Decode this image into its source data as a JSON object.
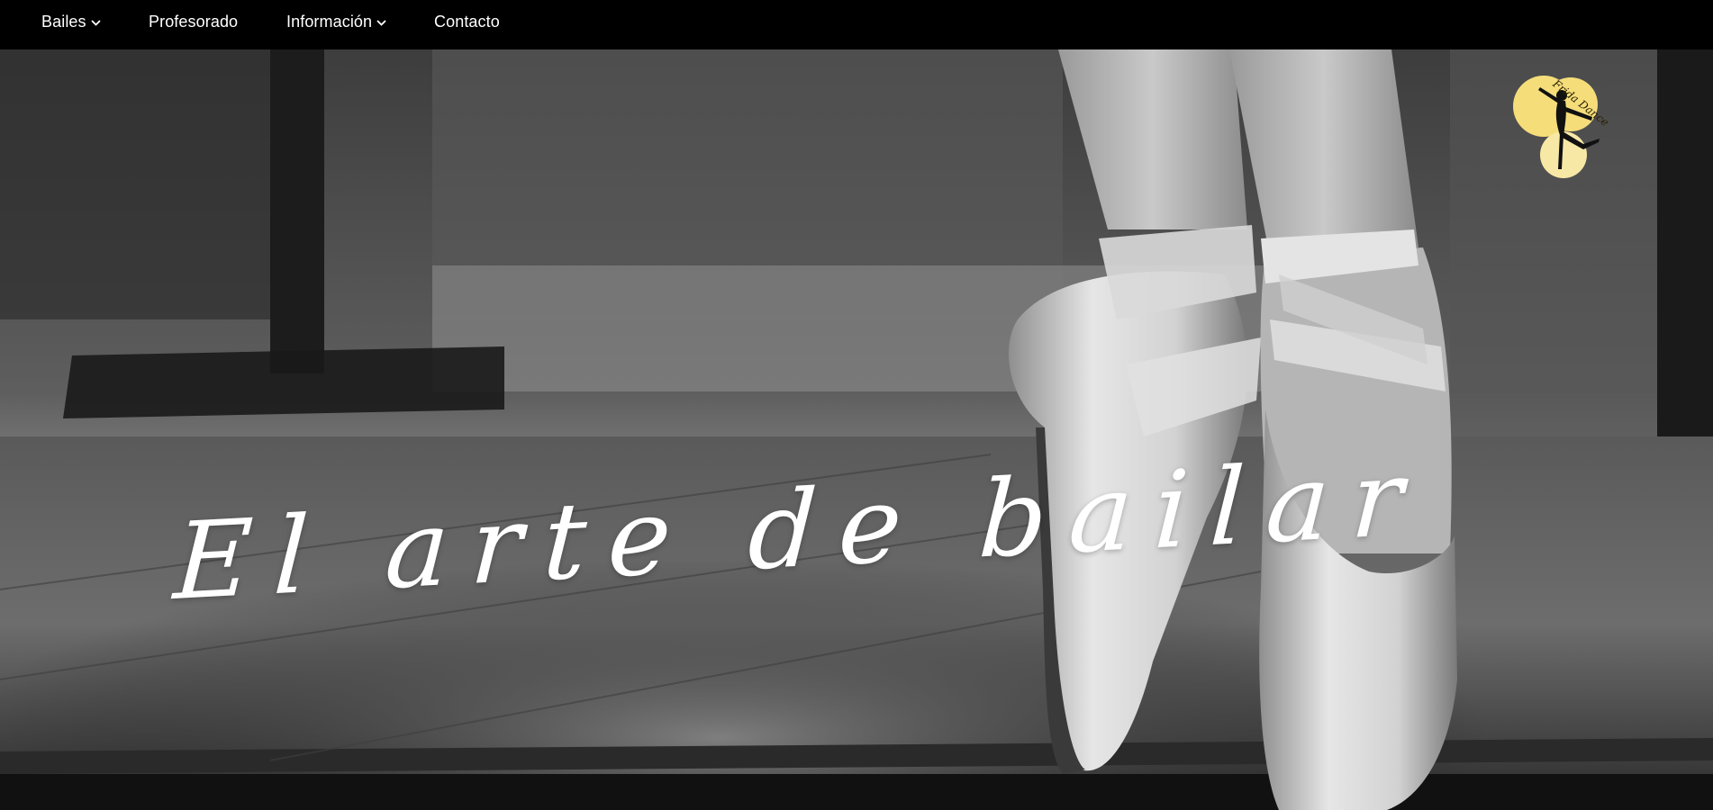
{
  "nav": {
    "items": [
      {
        "label": "Bailes",
        "has_dropdown": true
      },
      {
        "label": "Profesorado",
        "has_dropdown": false
      },
      {
        "label": "Información",
        "has_dropdown": true
      },
      {
        "label": "Contacto",
        "has_dropdown": false
      }
    ],
    "dropdown_icon": "chevron-down-icon"
  },
  "hero": {
    "title": "El arte de bailar",
    "image": "ballet-pointe-shoes-photo"
  },
  "logo": {
    "text": "Frida Dance",
    "accent_color": "#f5dd7a",
    "icon": "dancer-silhouette-icon"
  },
  "colors": {
    "navbar": "#000000",
    "nav_text": "#ffffff",
    "title_text": "#ffffff"
  }
}
